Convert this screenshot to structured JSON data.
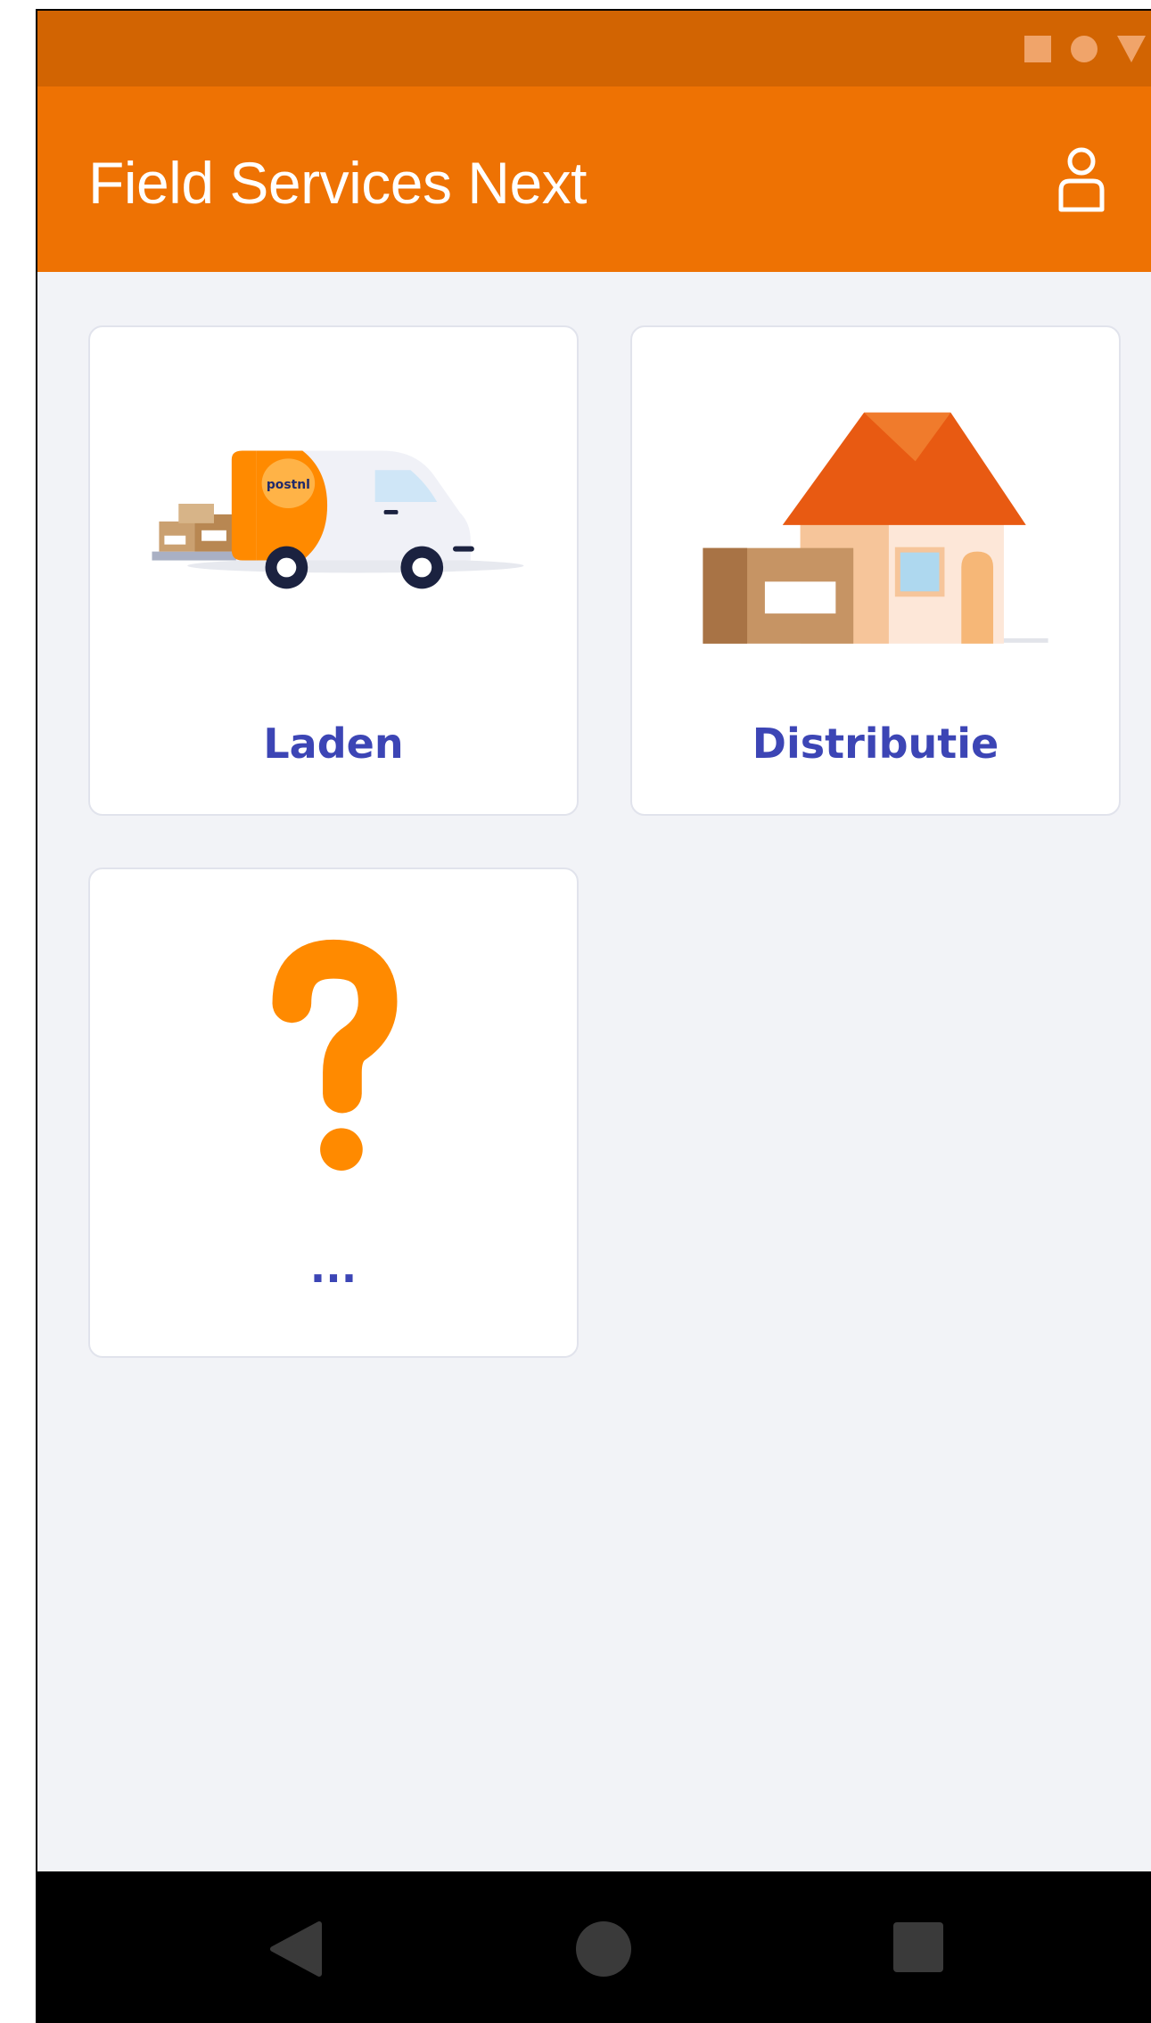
{
  "app_bar": {
    "title": "Field Services Next",
    "background_color": "#ee7203",
    "profile_icon": "user-icon"
  },
  "status_bar": {
    "background_color": "#d26402",
    "icons": [
      "square-icon",
      "circle-icon",
      "triangle-down-icon"
    ]
  },
  "tiles": [
    {
      "label": "Laden",
      "icon": "delivery-van-illustration"
    },
    {
      "label": "Distributie",
      "icon": "house-with-parcel-illustration"
    },
    {
      "label": "...",
      "icon": "question-mark-icon"
    }
  ],
  "van_logo_text": "postnl",
  "navigation_bar": {
    "buttons": [
      "back-icon",
      "home-icon",
      "recents-icon"
    ]
  },
  "colors": {
    "accent": "#ee7203",
    "label": "#3c45b5",
    "page_background": "#f2f3f7"
  }
}
